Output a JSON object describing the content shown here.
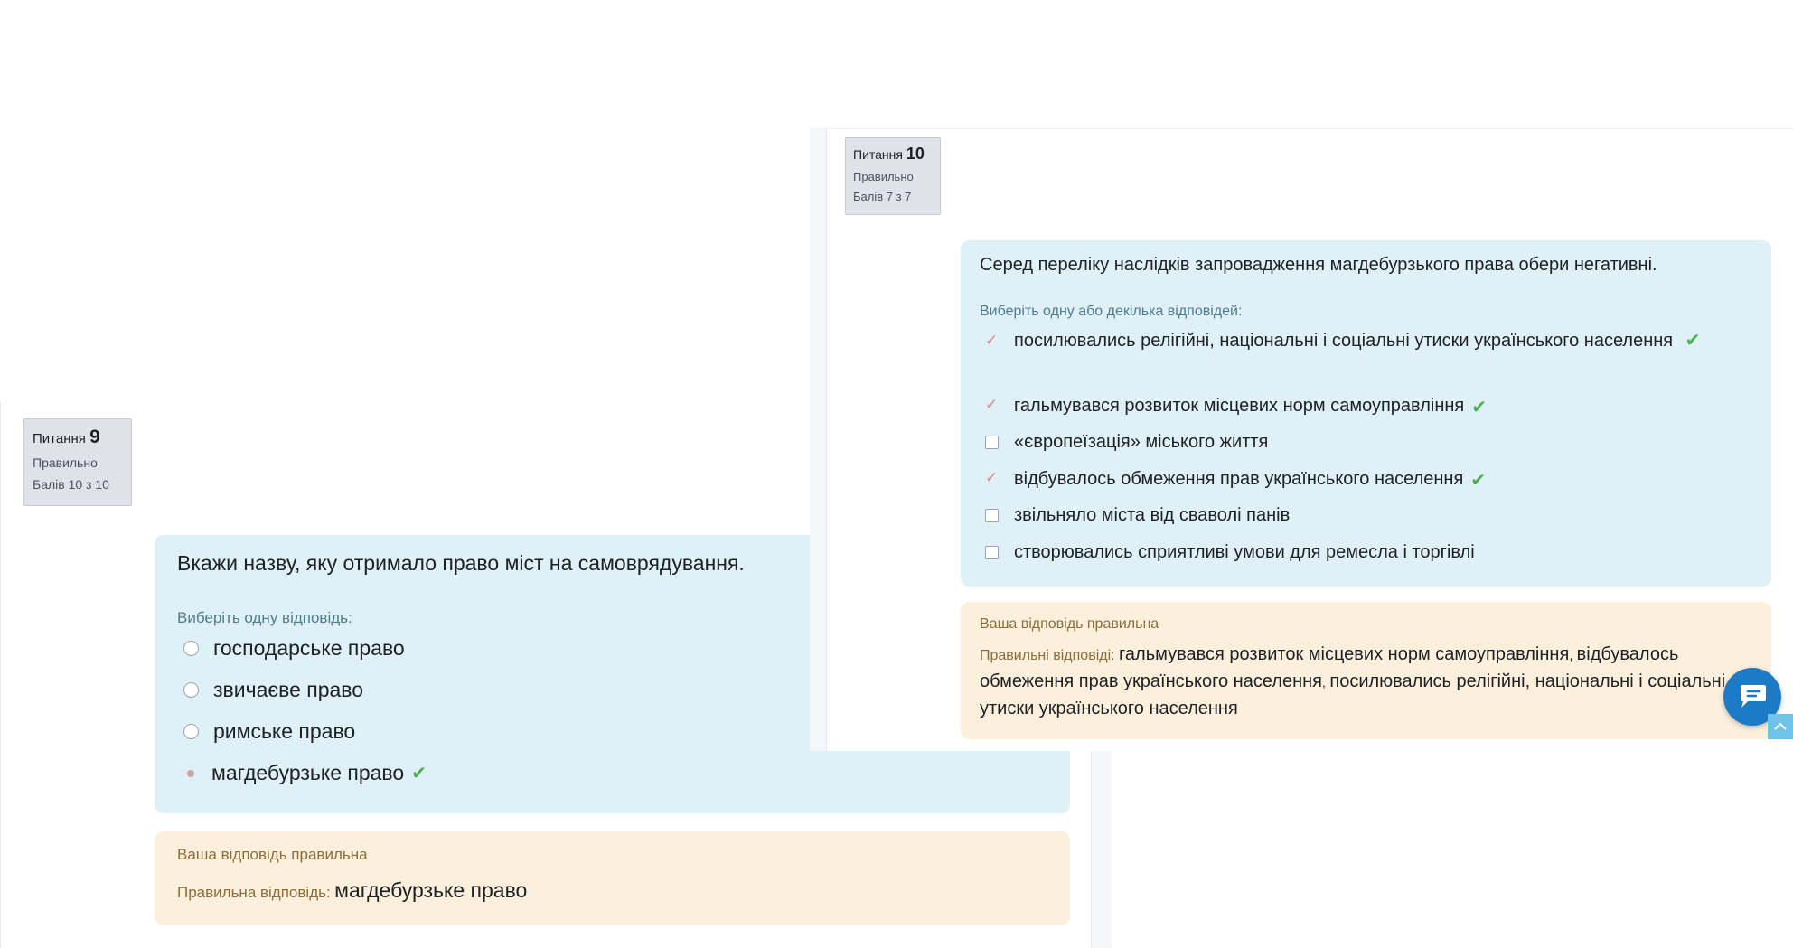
{
  "question9": {
    "info": {
      "label": "Питання",
      "number": "9",
      "status": "Правильно",
      "score": "Балів 10 з 10"
    },
    "text": "Вкажи назву, яку отримало право міст на самоврядування.",
    "prompt": "Виберіть одну відповідь:",
    "options": [
      {
        "label": "господарське право",
        "selected": false,
        "correct": false
      },
      {
        "label": "звичаєве право",
        "selected": false,
        "correct": false
      },
      {
        "label": "римське право",
        "selected": false,
        "correct": false
      },
      {
        "label": "магдебурзьке право",
        "selected": true,
        "correct": true
      }
    ],
    "feedback": {
      "title": "Ваша відповідь правильна",
      "answer_label": "Правильна відповідь:",
      "answer": "магдебурзьке право"
    }
  },
  "question10": {
    "info": {
      "label": "Питання",
      "number": "10",
      "status": "Правильно",
      "score": "Балів 7 з 7"
    },
    "text": "Серед переліку наслідків запровадження магдебурзького права обери негативні.",
    "prompt": "Виберіть одну або декілька відповідей:",
    "options": [
      {
        "label": "посилювались релігійні, національні і соціальні утиски українського населення",
        "selected": true,
        "correct": true
      },
      {
        "label": "гальмувався розвиток місцевих норм самоуправління",
        "selected": true,
        "correct": true
      },
      {
        "label": "«європеїзація» міського життя",
        "selected": false,
        "correct": false
      },
      {
        "label": "відбувалось обмеження прав українського населення",
        "selected": true,
        "correct": true
      },
      {
        "label": "звільняло міста від сваволі панів",
        "selected": false,
        "correct": false
      },
      {
        "label": "створювались сприятливі умови для ремесла і торгівлі",
        "selected": false,
        "correct": false
      }
    ],
    "feedback": {
      "title": "Ваша відповідь правильна",
      "answer_label": "Правильні відповіді:",
      "answer_part1": "гальмувався розвиток місцевих норм самоуправління",
      "sep1": ",",
      "answer_part2": "відбувалось обмеження прав українського населення",
      "sep2": ",",
      "answer_part3": "посилювались релігійні, національні і соціальні утиски українського населення"
    }
  },
  "icons": {
    "correct": "check-icon",
    "chat": "chat-icon",
    "scroll_top": "chevron-up-icon"
  },
  "colors": {
    "question_bg": "#dff0f6",
    "feedback_bg": "#fcefdc",
    "correct": "#4cae4f",
    "chat_button": "#1d7bc5"
  }
}
